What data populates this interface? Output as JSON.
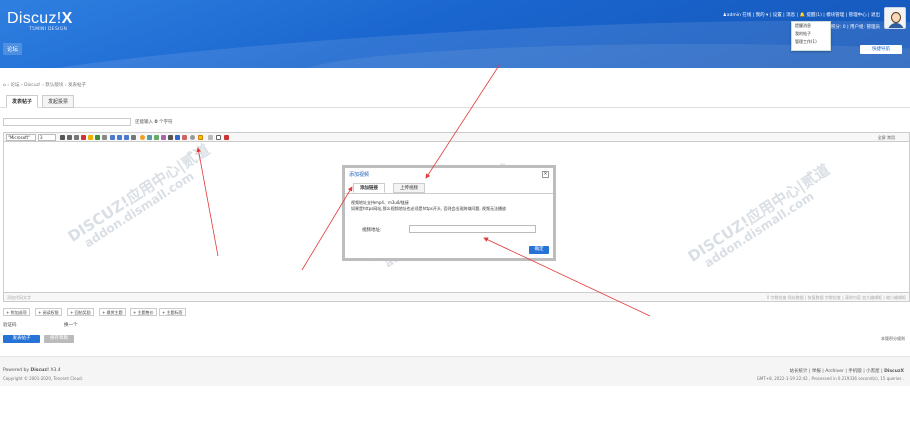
{
  "header": {
    "logo_main": "Discuz!",
    "logo_x": "X",
    "logo_sub": "T5MINI DESIGN",
    "nav_forum": "论坛",
    "user_bar_line1": "♟admin 在线 | 我的 ▾ | 设置 | 消息 | 🔔 提醒(1) | 模块管理 | 管理中心 | 退出",
    "user_bar_line2": "积分: 0 | 用户组: 管理员",
    "notice_items": [
      "提醒消息",
      "我的帖子",
      "管理工作(1)"
    ],
    "quick_post": "快捷导航"
  },
  "breadcrumb": "⌂ › 论坛 › Discuz! › 默认版块 › 发表帖子",
  "tabs": {
    "post": "发表帖子",
    "vote": "发起投票"
  },
  "title_hint_prefix": "还能输入",
  "title_hint_count": "0",
  "title_hint_suffix": "个字符",
  "toolbar": {
    "font": "\"Microsoft\"",
    "size": "3",
    "right": "全屏   常用"
  },
  "status": {
    "left": "添加代码文字",
    "right": "0 字数检查 保存数据 | 恢复数据  字数检查 | 清除内容  加大编辑框 | 缩小编辑框"
  },
  "options": [
    "+ 附加选项",
    "+ 阅读权限",
    "+ 回帖奖励",
    "+ 悬赏主题",
    "+ 主题售价",
    "+ 主题标签"
  ],
  "verify_label": "验证码",
  "verify_val": "换一个",
  "btn_post": "发表帖子",
  "btn_draft": "保存草稿",
  "rules_link": "本版积分规则",
  "footer": {
    "l1_prefix": "Powered by",
    "l1_brand": "Discuz!",
    "l1_ver": "X3.4",
    "l2": "Copyright © 2001-2020, Tencent Cloud.",
    "r1_links": "站长统计 | 举报 | Archiver | 手机版 | 小黑屋 |",
    "r1_brand": "DiscuzX",
    "r2": "GMT+8, 2022-1-19 22:42 , Processed in 0.219336 second(s), 15 queries ."
  },
  "modal": {
    "title": "添加视频",
    "tab_active": "添加链接",
    "tab_other": "上传视频",
    "info_line1": "视频地址支持mp4、m3u8/链接",
    "info_line2": "如果是https网站,那么视频地址也必须是https开头, 否则会出现跨域问题, 视频无法播放",
    "field_label": "视频地址:",
    "ok": "确定",
    "close": "×"
  },
  "watermark": {
    "main": "DISCUZ!应用中心|贰道",
    "sub": "addon.dismall.com"
  },
  "colors": {
    "header": "#1a66cf",
    "button": "#2672d6",
    "arrow": "#e23b3b"
  }
}
